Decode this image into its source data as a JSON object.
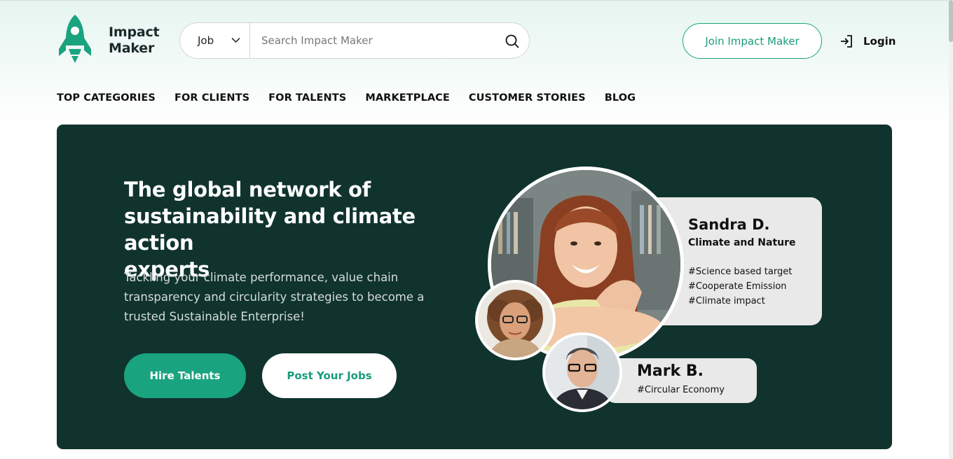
{
  "brand": {
    "name_line1": "Impact",
    "name_line2": "Maker",
    "color": "#1aa37f"
  },
  "search": {
    "category": "Job",
    "placeholder": "Search Impact Maker",
    "icon": "search-icon"
  },
  "header": {
    "join_label": "Join Impact Maker",
    "login_label": "Login",
    "login_icon": "login-icon"
  },
  "nav": {
    "items": [
      {
        "label": "TOP CATEGORIES"
      },
      {
        "label": "FOR CLIENTS"
      },
      {
        "label": "FOR TALENTS"
      },
      {
        "label": "MARKETPLACE"
      },
      {
        "label": "CUSTOMER STORIES"
      },
      {
        "label": "BLOG"
      }
    ]
  },
  "hero": {
    "title_line1": "The global network of",
    "title_line2": "sustainability and climate action",
    "title_line3": "experts",
    "desc_line1": "Tackling your climate performance, value chain",
    "desc_line2": "transparency and circularity strategies to become a",
    "desc_line3": "trusted Sustainable Enterprise!",
    "hire_label": "Hire Talents",
    "post_label": "Post Your Jobs",
    "background_color": "#10332d"
  },
  "profiles": {
    "main": {
      "name": "Sandra D.",
      "role": "Climate and Nature",
      "tags": [
        "#Science based target",
        "#Cooperate Emission",
        "#Climate impact"
      ]
    },
    "second": {
      "name": "Mark B.",
      "tag": "#Circular Economy"
    }
  }
}
